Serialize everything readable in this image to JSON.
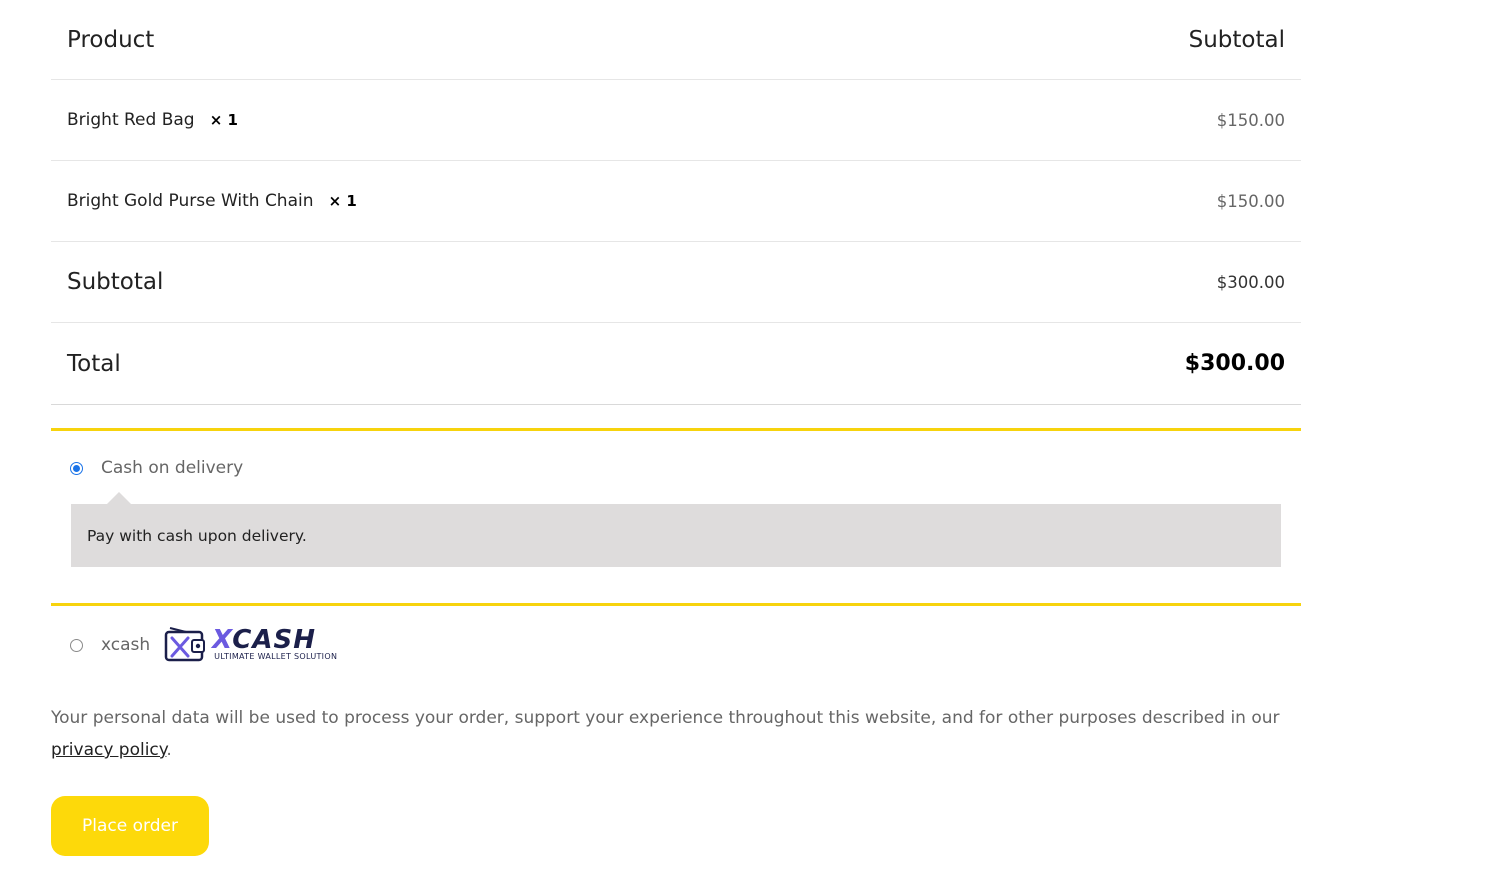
{
  "table": {
    "product_header": "Product",
    "subtotal_header": "Subtotal",
    "items": [
      {
        "name": "Bright Red Bag",
        "qty": "× 1",
        "price": "$150.00"
      },
      {
        "name": "Bright Gold Purse With Chain",
        "qty": "× 1",
        "price": "$150.00"
      }
    ],
    "subtotal_label": "Subtotal",
    "subtotal_value": "$300.00",
    "total_label": "Total",
    "total_value": "$300.00"
  },
  "payment": {
    "accent_color": "#f7d30d",
    "methods": [
      {
        "label": "Cash on delivery",
        "selected": true,
        "description": "Pay with cash upon delivery."
      },
      {
        "label": "xcash",
        "selected": false,
        "logo": {
          "word_accent": "X",
          "word_rest": "CASH",
          "tagline": "ULTIMATE WALLET SOLUTION"
        }
      }
    ]
  },
  "privacy": {
    "text_before": "Your personal data will be used to process your order, support your experience throughout this website, and for other purposes described in our ",
    "link_text": "privacy policy",
    "text_after": "."
  },
  "actions": {
    "place_order_label": "Place order",
    "button_color": "#fdd90a"
  }
}
